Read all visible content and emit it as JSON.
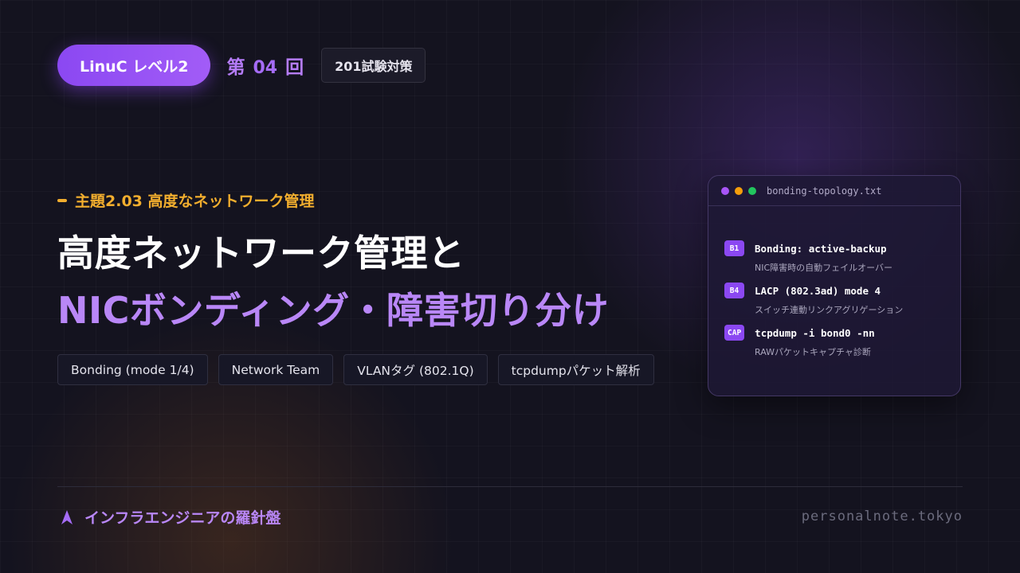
{
  "header": {
    "level_label": "LinuC レベル2",
    "episode_prefix": "第",
    "episode_number": "04",
    "episode_suffix": "回",
    "exam_label": "201試験対策"
  },
  "subtopic": "主題2.03 高度なネットワーク管理",
  "title": {
    "line1": "高度ネットワーク管理と",
    "line2": "NICボンディング・障害切り分け"
  },
  "tags": [
    "Bonding (mode 1/4)",
    "Network Team",
    "VLANタグ (802.1Q)",
    "tcpdumpパケット解析"
  ],
  "terminal": {
    "filename": "bonding-topology.txt",
    "dot_colors": [
      "#a855f7",
      "#f59e0b",
      "#22c55e"
    ],
    "entries": [
      {
        "badge": "B1",
        "command": "Bonding: active-backup",
        "description": "NIC障害時の自動フェイルオーバー"
      },
      {
        "badge": "B4",
        "command": "LACP (802.3ad) mode 4",
        "description": "スイッチ連動リンクアグリゲーション"
      },
      {
        "badge": "CAP",
        "command": "tcpdump -i bond0 -nn",
        "description": "RAWパケットキャプチャ診断"
      }
    ]
  },
  "footer": {
    "brand": "インフラエンジニアの羅針盤",
    "brand_icon": "compass-arrow-icon",
    "site": "personalnote.tokyo"
  },
  "colors": {
    "accent_purple": "#8b48f2",
    "accent_orange": "#f2ae2e",
    "title_purple": "#b987f7",
    "background": "#14131f"
  }
}
